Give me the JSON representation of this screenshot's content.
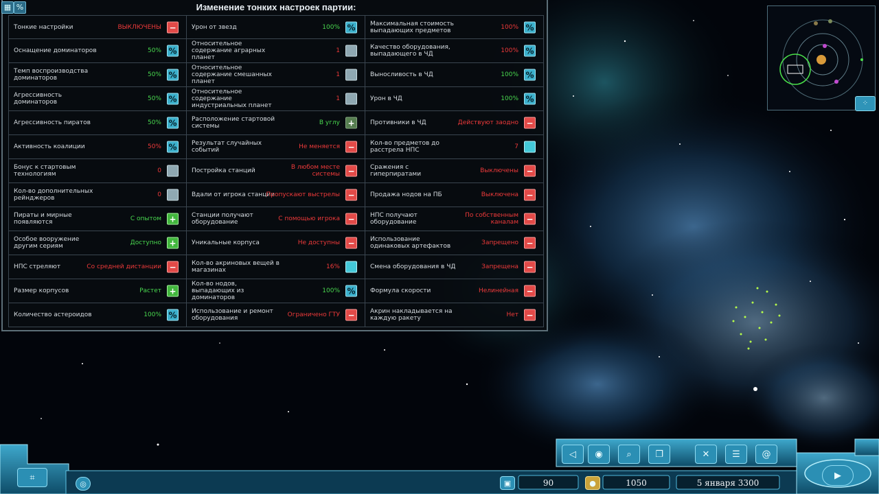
{
  "panel": {
    "title": "Изменение тонких настроек партии:",
    "rows": [
      [
        {
          "label": "Тонкие настройки",
          "value": "ВЫКЛЮЧЕНЫ",
          "color": "r",
          "btn": "minus"
        },
        {
          "label": "Урон от звезд",
          "value": "100%",
          "color": "g",
          "btn": "pct"
        },
        {
          "label": "Максимальная стоимость выпадающих предметов",
          "value": "100%",
          "color": "r",
          "btn": "pct"
        }
      ],
      [
        {
          "label": "Оснащение доминаторов",
          "value": "50%",
          "color": "g",
          "btn": "pct"
        },
        {
          "label": "Относительное содержание аграрных планет",
          "value": "1",
          "color": "r",
          "btn": "grey"
        },
        {
          "label": "Качество оборудования, выпадающего в ЧД",
          "value": "100%",
          "color": "r",
          "btn": "pct"
        }
      ],
      [
        {
          "label": "Темп воспроизводства доминаторов",
          "value": "50%",
          "color": "g",
          "btn": "pct"
        },
        {
          "label": "Относительное содержание смешанных планет",
          "value": "1",
          "color": "r",
          "btn": "grey"
        },
        {
          "label": "Выносливость в ЧД",
          "value": "100%",
          "color": "g",
          "btn": "pct"
        }
      ],
      [
        {
          "label": "Агрессивность доминаторов",
          "value": "50%",
          "color": "g",
          "btn": "pct"
        },
        {
          "label": "Относительное содержание индустриальных планет",
          "value": "1",
          "color": "r",
          "btn": "grey"
        },
        {
          "label": "Урон в ЧД",
          "value": "100%",
          "color": "g",
          "btn": "pct"
        }
      ],
      [
        {
          "label": "Агрессивность пиратов",
          "value": "50%",
          "color": "g",
          "btn": "pct"
        },
        {
          "label": "Расположение стартовой системы",
          "value": "В углу",
          "color": "g",
          "btn": "plusdim"
        },
        {
          "label": "Противники в ЧД",
          "value": "Действуют заодно",
          "color": "r",
          "btn": "minus"
        }
      ],
      [
        {
          "label": "Активность коалиции",
          "value": "50%",
          "color": "r",
          "btn": "pct"
        },
        {
          "label": "Результат случайных событий",
          "value": "Не меняется",
          "color": "r",
          "btn": "minus"
        },
        {
          "label": "Кол-во предметов до расстрела НПС",
          "value": "7",
          "color": "r",
          "btn": "cyan"
        }
      ],
      [
        {
          "label": "Бонус к стартовым технологиям",
          "value": "0",
          "color": "r",
          "btn": "grey"
        },
        {
          "label": "Постройка станций",
          "value": "В любом месте системы",
          "color": "r",
          "btn": "minus"
        },
        {
          "label": "Сражения с гиперпиратами",
          "value": "Выключены",
          "color": "r",
          "btn": "minus"
        }
      ],
      [
        {
          "label": "Кол-во дополнительных рейнджеров",
          "value": "0",
          "color": "r",
          "btn": "grey"
        },
        {
          "label": "Вдали от игрока станции",
          "value": "Пропускают выстрелы",
          "color": "r",
          "btn": "minus"
        },
        {
          "label": "Продажа нодов на ПБ",
          "value": "Выключена",
          "color": "r",
          "btn": "minus"
        }
      ],
      [
        {
          "label": "Пираты и мирные появляются",
          "value": "С опытом",
          "color": "g",
          "btn": "plus"
        },
        {
          "label": "Станции получают оборудование",
          "value": "С помощью игрока",
          "color": "r",
          "btn": "minus"
        },
        {
          "label": "НПС получают оборудование",
          "value": "По собственным каналам",
          "color": "r",
          "btn": "minus"
        }
      ],
      [
        {
          "label": "Особое вооружение другим сериям",
          "value": "Доступно",
          "color": "g",
          "btn": "plus"
        },
        {
          "label": "Уникальные корпуса",
          "value": "Не доступны",
          "color": "r",
          "btn": "minus"
        },
        {
          "label": "Использование одинаковых артефактов",
          "value": "Запрещено",
          "color": "r",
          "btn": "minus"
        }
      ],
      [
        {
          "label": "НПС стреляют",
          "value": "Со средней дистанции",
          "color": "r",
          "btn": "minus"
        },
        {
          "label": "Кол-во акриновых вещей в магазинах",
          "value": "16%",
          "color": "r",
          "btn": "cyan"
        },
        {
          "label": "Смена оборудования в ЧД",
          "value": "Запрещена",
          "color": "r",
          "btn": "minus"
        }
      ],
      [
        {
          "label": "Размер корпусов",
          "value": "Растет",
          "color": "g",
          "btn": "plus"
        },
        {
          "label": "Кол-во нодов, выпадающих из доминаторов",
          "value": "100%",
          "color": "g",
          "btn": "pct"
        },
        {
          "label": "Формула скорости",
          "value": "Нелинейная",
          "color": "r",
          "btn": "minus"
        }
      ],
      [
        {
          "label": "Количество астероидов",
          "value": "100%",
          "color": "g",
          "btn": "pct"
        },
        {
          "label": "Использование и ремонт оборудования",
          "value": "Ограничено ГТУ",
          "color": "r",
          "btn": "minus"
        },
        {
          "label": "Акрин накладывается на каждую ракету",
          "value": "Нет",
          "color": "r",
          "btn": "minus"
        }
      ]
    ]
  },
  "hud": {
    "value_90": "90",
    "credits": "1050",
    "date": "5 января 3300"
  },
  "icons": {
    "top_left_1": "grid-icon",
    "top_left_2": "percent-icon",
    "hud_buttons": [
      "back-arrow-icon",
      "planet-icon",
      "search-icon",
      "screens-icon",
      "tools-icon",
      "list-icon",
      "spiral-icon",
      "map-icon",
      "play-icon",
      "coin-icon",
      "cargo-icon"
    ]
  },
  "colors": {
    "green": "#49d84f",
    "red": "#ee3a3a",
    "cyan": "#3bb0cc"
  }
}
